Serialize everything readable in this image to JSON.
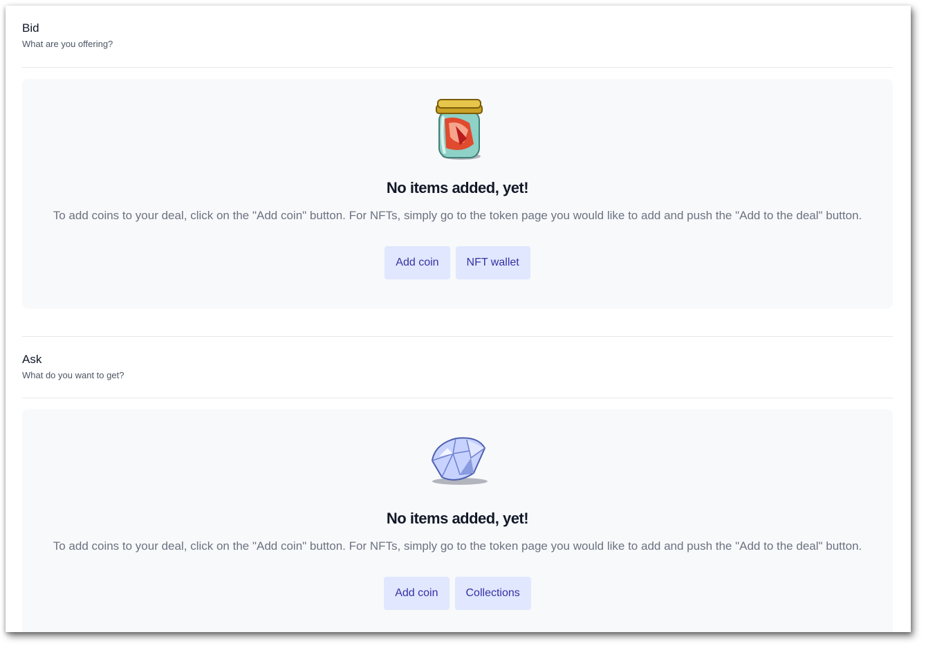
{
  "bid": {
    "title": "Bid",
    "subtitle": "What are you offering?",
    "empty_title": "No items added, yet!",
    "empty_text": "To add coins to your deal, click on the \"Add coin\" button. For NFTs, simply go to the token page you would like to add and push the \"Add to the deal\" button.",
    "illustration": "jar-icon",
    "buttons": {
      "add_coin": "Add coin",
      "secondary": "NFT wallet"
    }
  },
  "ask": {
    "title": "Ask",
    "subtitle": "What do you want to get?",
    "empty_title": "No items added, yet!",
    "empty_text": "To add coins to your deal, click on the \"Add coin\" button. For NFTs, simply go to the token page you would like to add and push the \"Add to the deal\" button.",
    "illustration": "diamond-icon",
    "buttons": {
      "add_coin": "Add coin",
      "secondary": "Collections"
    }
  },
  "colors": {
    "panel_bg": "#f8f9fb",
    "button_bg": "#e0e7ff",
    "button_text": "#3730a3",
    "divider": "#e5e7eb"
  }
}
